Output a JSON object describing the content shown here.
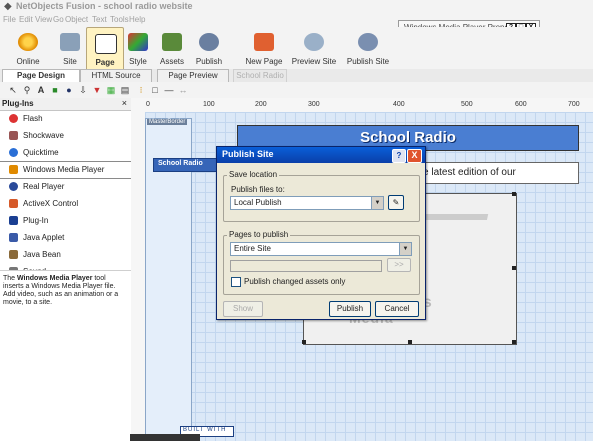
{
  "app": {
    "title": "NetObjects Fusion - school radio website"
  },
  "menu": [
    "File",
    "Edit",
    "View",
    "Go",
    "Object",
    "Text",
    "Tools",
    "Help"
  ],
  "properties_window": {
    "title": "Windows Media Player Prope",
    "buttons": [
      "?",
      "□",
      "X"
    ]
  },
  "toolbar": [
    {
      "label": "Online",
      "icon": "online-icon"
    },
    {
      "label": "Site",
      "icon": "site-icon"
    },
    {
      "label": "Page",
      "icon": "page-icon"
    },
    {
      "label": "Style",
      "icon": "style-icon"
    },
    {
      "label": "Assets",
      "icon": "assets-icon"
    },
    {
      "label": "Publish",
      "icon": "publish-icon"
    },
    {
      "label": "New Page",
      "icon": "new-page-icon"
    },
    {
      "label": "Preview Site",
      "icon": "preview-site-icon"
    },
    {
      "label": "Publish Site",
      "icon": "publish-site-icon"
    }
  ],
  "tabs": [
    "Page Design",
    "HTML Source",
    "Page Preview",
    "School Radio"
  ],
  "plugins": {
    "header": "Plug-Ins",
    "close": "×",
    "items": [
      "Flash",
      "Shockwave",
      "Quicktime",
      "Windows Media Player",
      "Real Player",
      "ActiveX Control",
      "Plug-In",
      "Java Applet",
      "Java Bean",
      "Sound"
    ],
    "description_bold": "Windows Media Player",
    "description_pre": "The ",
    "description_post": " tool inserts a Windows Media Player file. Add video, such as an animation or a movie, to a site."
  },
  "ruler": {
    "labels": [
      "0",
      "100",
      "200",
      "300",
      "400",
      "500",
      "600",
      "700"
    ]
  },
  "page": {
    "masterborder": "MasterBorder",
    "banner": "School Radio",
    "nav_button": "School Radio",
    "body_text": "can hear the latest edition of our",
    "media_text": "Media",
    "media_vs": "vs",
    "built_with": "BUILT WITH"
  },
  "dialog": {
    "title": "Publish Site",
    "help": "?",
    "close": "X",
    "save_location_label": "Save location",
    "publish_files_to": "Publish files to:",
    "publish_target": "Local Publish",
    "pages_group_label": "Pages to publish",
    "pages_value": "Entire Site",
    "browse": ">>",
    "publish_changed_only": "Publish changed assets only",
    "show_button": "Show",
    "publish_button": "Publish",
    "cancel_button": "Cancel"
  }
}
